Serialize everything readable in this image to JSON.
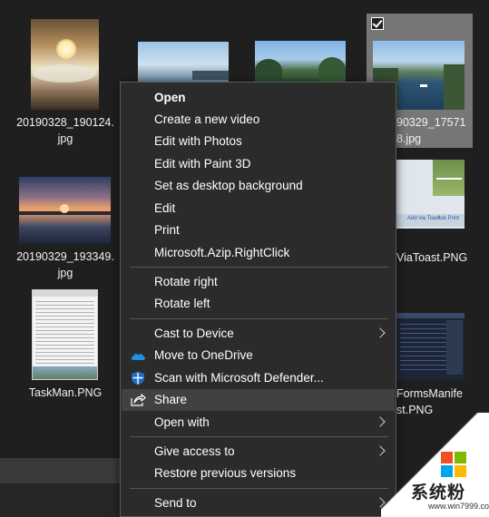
{
  "files": [
    {
      "name": "20190328_190124.jpg"
    },
    {
      "name": ""
    },
    {
      "name": ""
    },
    {
      "name": "20190329_175718.jpg",
      "visible_name": "90329_17571\n8.jpg"
    },
    {
      "name": "20190329_193349.jpg"
    },
    {
      "name": "ViaToast.PNG"
    },
    {
      "name": "TaskMan.PNG"
    },
    {
      "name": "FormsManifest.PNG",
      "visible_name": "FormsManife\nst.PNG"
    }
  ],
  "thumb_text": {
    "add_via_toast": "Add via Toast",
    "ask_print": "Ask Print"
  },
  "context_menu": {
    "items": [
      {
        "label": "Open",
        "bold": true
      },
      {
        "label": "Create a new video"
      },
      {
        "label": "Edit with Photos"
      },
      {
        "label": "Edit with Paint 3D"
      },
      {
        "label": "Set as desktop background"
      },
      {
        "label": "Edit"
      },
      {
        "label": "Print"
      },
      {
        "label": "Microsoft.Azip.RightClick"
      },
      {
        "label": "Rotate right"
      },
      {
        "label": "Rotate left"
      },
      {
        "label": "Cast to Device",
        "submenu": true
      },
      {
        "label": "Move to OneDrive",
        "icon": "onedrive-icon"
      },
      {
        "label": "Scan with Microsoft Defender...",
        "icon": "defender-shield-icon"
      },
      {
        "label": "Share",
        "icon": "share-icon",
        "highlighted": true
      },
      {
        "label": "Open with",
        "submenu": true
      },
      {
        "label": "Give access to",
        "submenu": true
      },
      {
        "label": "Restore previous versions"
      },
      {
        "label": "Send to",
        "submenu": true
      }
    ]
  },
  "watermark": {
    "text_cn": "系统粉",
    "url": "www.win7999.com"
  },
  "colors": {
    "background": "#1f1f1f",
    "menu": "#2b2b2b",
    "hover": "#414141",
    "selection": "#777777"
  }
}
